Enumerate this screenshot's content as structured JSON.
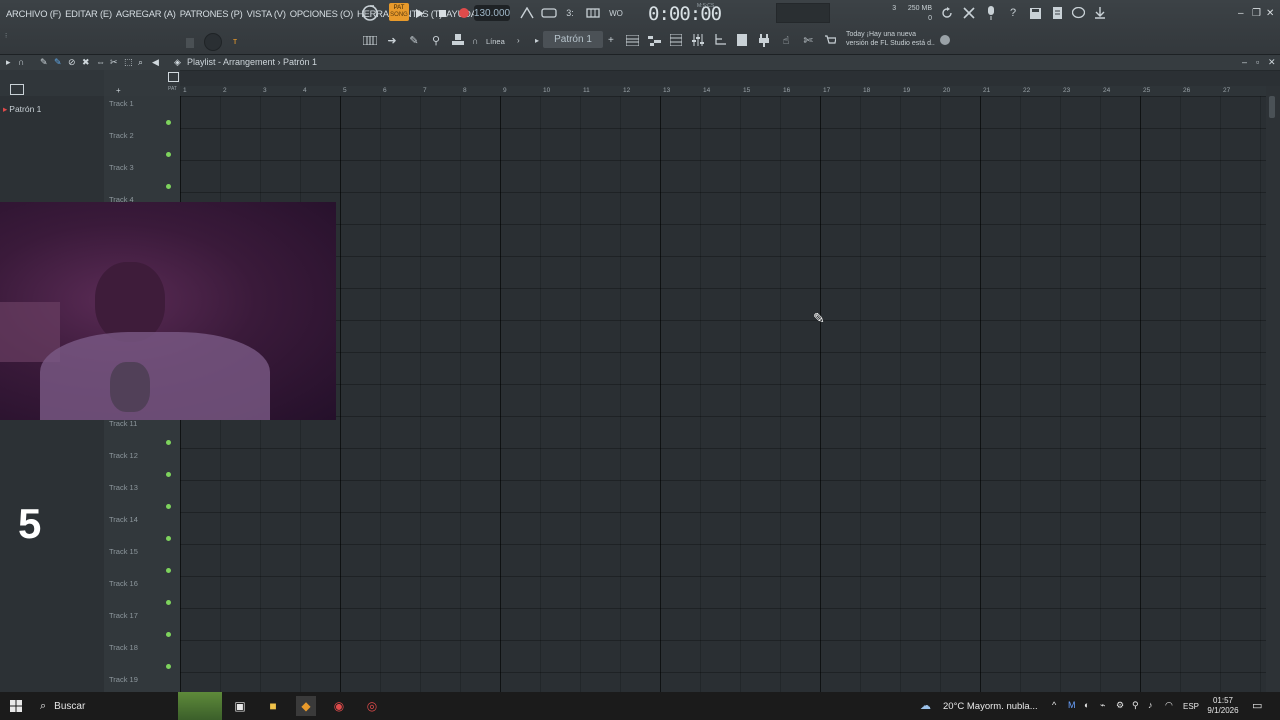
{
  "menu": {
    "items": [
      "ARCHIVO (F)",
      "EDITAR (E)",
      "AGREGAR (A)",
      "PATRONES (P)",
      "VISTA (V)",
      "OPCIONES (O)",
      "HERRAMIENTAS (T)",
      "AYUDA"
    ]
  },
  "transport": {
    "pat_label": "PAT",
    "song_label": "SONG",
    "tempo": "130.000",
    "time": "0:00:00",
    "time_unit": "M:S:CS"
  },
  "monitor": {
    "cpu_val": "3",
    "ram": "250 MB",
    "polyphony": "0"
  },
  "toolbar": {
    "snap": "Línea",
    "pattern": "Patrón 1",
    "news_line1": "Today  ¡Hay una nueva",
    "news_line2": "versión de FL Studio está d.."
  },
  "playlist": {
    "title": "Playlist - Arrangement › Patrón 1",
    "header_hint": "PAT"
  },
  "browser": {
    "pattern_entry": "Patrón 1"
  },
  "overlay": {
    "big_number": "5"
  },
  "timeline": {
    "bars": [
      "1",
      "2",
      "3",
      "4",
      "5",
      "6",
      "7",
      "8",
      "9",
      "10",
      "11",
      "12",
      "13",
      "14",
      "15",
      "16",
      "17",
      "18",
      "19",
      "20",
      "21",
      "22",
      "23",
      "24",
      "25",
      "26",
      "27"
    ]
  },
  "tracks": [
    {
      "label": "Track 1",
      "visible": true
    },
    {
      "label": "Track 2",
      "visible": true
    },
    {
      "label": "Track 3",
      "visible": true
    },
    {
      "label": "Track 4",
      "visible": true
    },
    {
      "label": "Track 11",
      "visible": true
    },
    {
      "label": "Track 12",
      "visible": true
    },
    {
      "label": "Track 13",
      "visible": true
    },
    {
      "label": "Track 14",
      "visible": true
    },
    {
      "label": "Track 15",
      "visible": true
    },
    {
      "label": "Track 16",
      "visible": true
    },
    {
      "label": "Track 17",
      "visible": true
    },
    {
      "label": "Track 18",
      "visible": true
    },
    {
      "label": "Track 19",
      "visible": true
    }
  ],
  "taskbar": {
    "search_label": "Buscar",
    "weather": "20°C  Mayorm. nubla...",
    "lang": "ESP",
    "time": "01:57",
    "date": "9/1/2026"
  },
  "colors": {
    "accent_orange": "#e89a2b",
    "record_red": "#e04b4b",
    "led_green": "#7ed35d"
  }
}
